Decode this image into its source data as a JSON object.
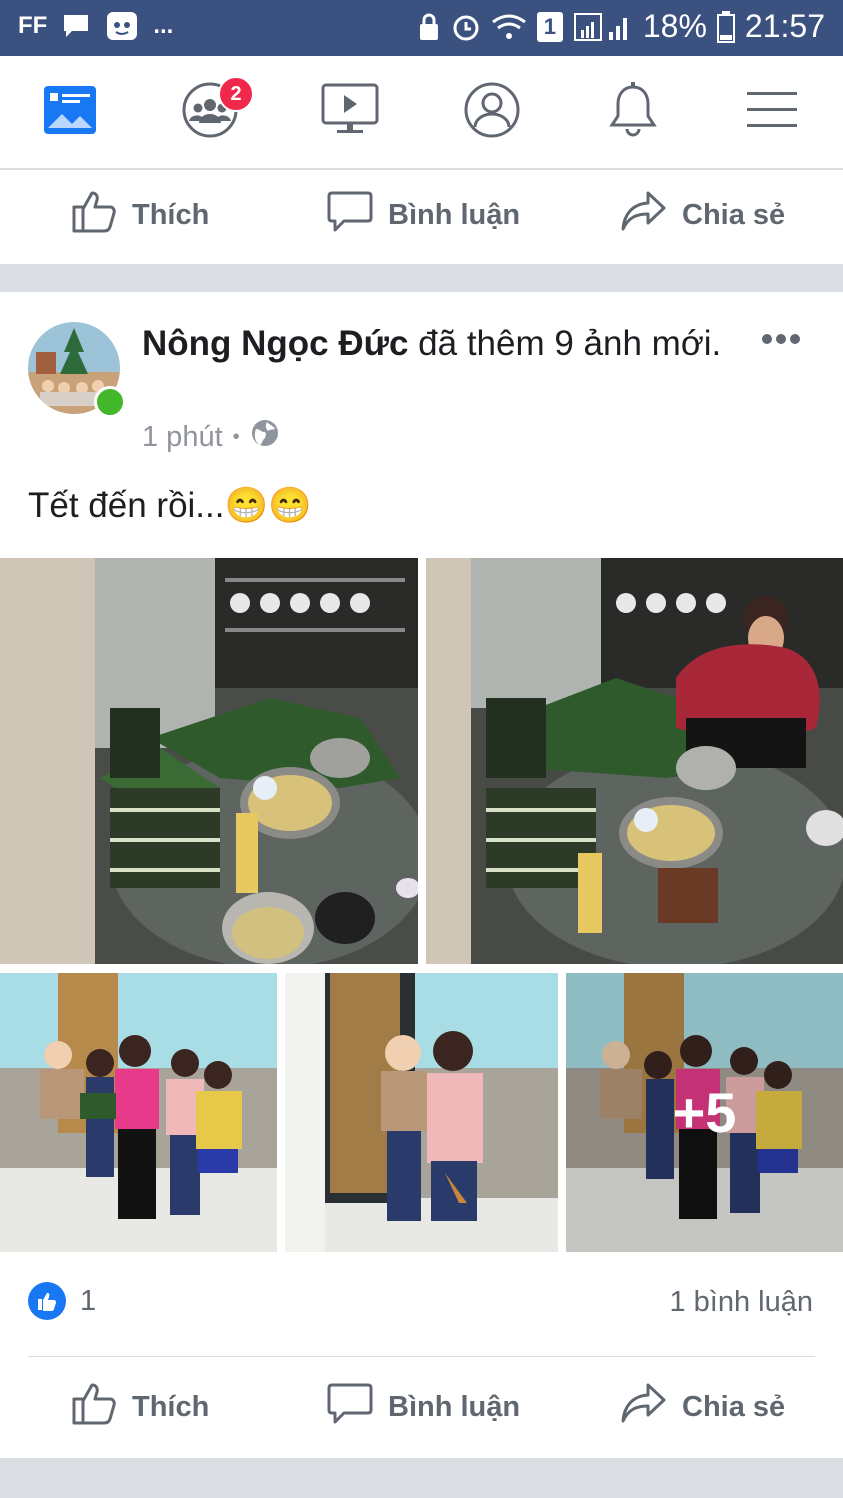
{
  "status_bar": {
    "left_label": "FF",
    "dots": "...",
    "sim_slot": "1",
    "battery": "18%",
    "time": "21:57",
    "color": "#3b5180"
  },
  "nav": {
    "items": [
      {
        "icon": "news-feed-icon"
      },
      {
        "icon": "friends-icon",
        "badge": "2"
      },
      {
        "icon": "watch-video-icon"
      },
      {
        "icon": "profile-icon"
      },
      {
        "icon": "notifications-bell-icon"
      },
      {
        "icon": "menu-icon"
      }
    ]
  },
  "actions": {
    "like": "Thích",
    "comment": "Bình luận",
    "share": "Chia sẻ"
  },
  "post": {
    "author": "Nông Ngọc Đức",
    "action_text": " đã thêm 9 ảnh mới.",
    "time": "1 phút",
    "dot": "•",
    "text": "Tết đến rồi...😁😁",
    "more_photos": "+5",
    "reaction_count": "1",
    "comment_count": "1 bình luận"
  },
  "colors": {
    "accent": "#1877f2",
    "secondary_text": "#606770",
    "online": "#42b72a",
    "badge": "#f02849"
  }
}
